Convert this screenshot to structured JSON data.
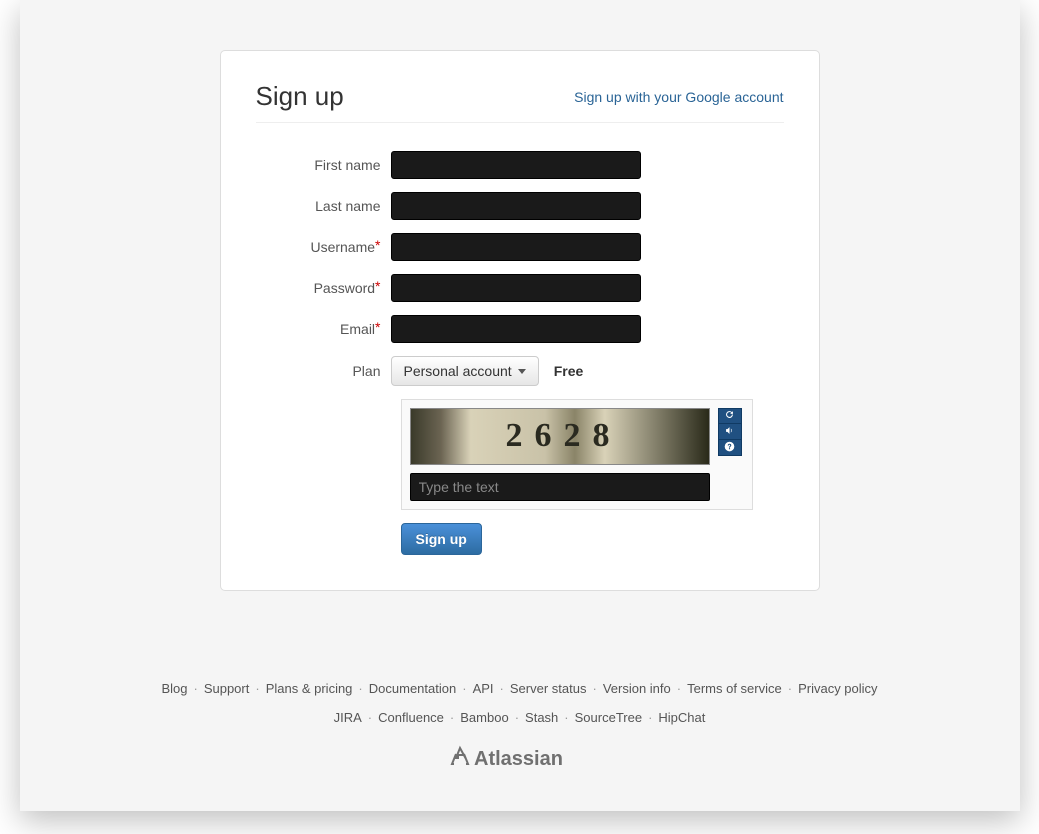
{
  "header": {
    "title": "Sign up",
    "google_link": "Sign up with your Google account"
  },
  "labels": {
    "first_name": "First name",
    "last_name": "Last name",
    "username": "Username",
    "password": "Password",
    "email": "Email",
    "plan": "Plan"
  },
  "values": {
    "first_name": "",
    "last_name": "",
    "username": "",
    "password": "",
    "email": ""
  },
  "plan": {
    "selected": "Personal account",
    "price": "Free"
  },
  "captcha": {
    "display_text": "2628",
    "placeholder": "Type the text",
    "value": ""
  },
  "submit_label": "Sign up",
  "footer": {
    "row1": [
      "Blog",
      "Support",
      "Plans & pricing",
      "Documentation",
      "API",
      "Server status",
      "Version info",
      "Terms of service",
      "Privacy policy"
    ],
    "row2": [
      "JIRA",
      "Confluence",
      "Bamboo",
      "Stash",
      "SourceTree",
      "HipChat"
    ],
    "brand": "Atlassian"
  }
}
